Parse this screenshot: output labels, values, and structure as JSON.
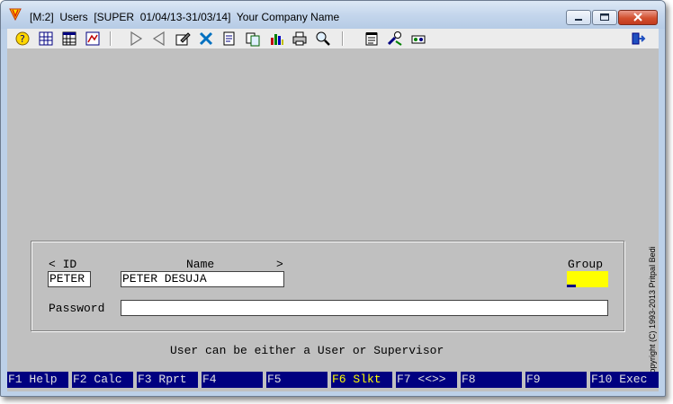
{
  "window": {
    "title": "[M:2]  Users  [SUPER  01/04/13-31/03/14]  Your Company Name",
    "buttons": [
      "minimize",
      "maximize",
      "close"
    ]
  },
  "toolbar": {
    "icons": [
      "help-icon",
      "grid-icon",
      "table-icon",
      "report-icon",
      "next-icon",
      "previous-icon",
      "edit-icon",
      "delete-icon",
      "new-record-icon",
      "copy-icon",
      "chart-icon",
      "print-icon",
      "find-icon",
      "notes-icon",
      "tools-icon",
      "settings-icon",
      "exit-icon"
    ]
  },
  "copyright": "Copyright  (C)  1993-2013  Pritpal Bedi",
  "form": {
    "id_label": "< ID",
    "name_label": "Name",
    "more_label": ">",
    "group_label": "Group",
    "id_value": "PETER",
    "name_value": "PETER DESUJA",
    "group_value": "",
    "password_label": "Password",
    "password_value": ""
  },
  "message": "User can be either a User or Supervisor",
  "fkeys": [
    "F1 Help",
    "F2 Calc",
    "F3 Rprt",
    "F4",
    "F5",
    "F6 Slkt",
    "F7 <<>>",
    "F8",
    "F9",
    "F10 Exec"
  ],
  "colors": {
    "fkey_bg": "#000080",
    "fkey_text": "#e0e0e0",
    "fkey_highlight": "#ffff00",
    "group_field": "#ffff00",
    "client_bg": "#c0c0c0"
  }
}
